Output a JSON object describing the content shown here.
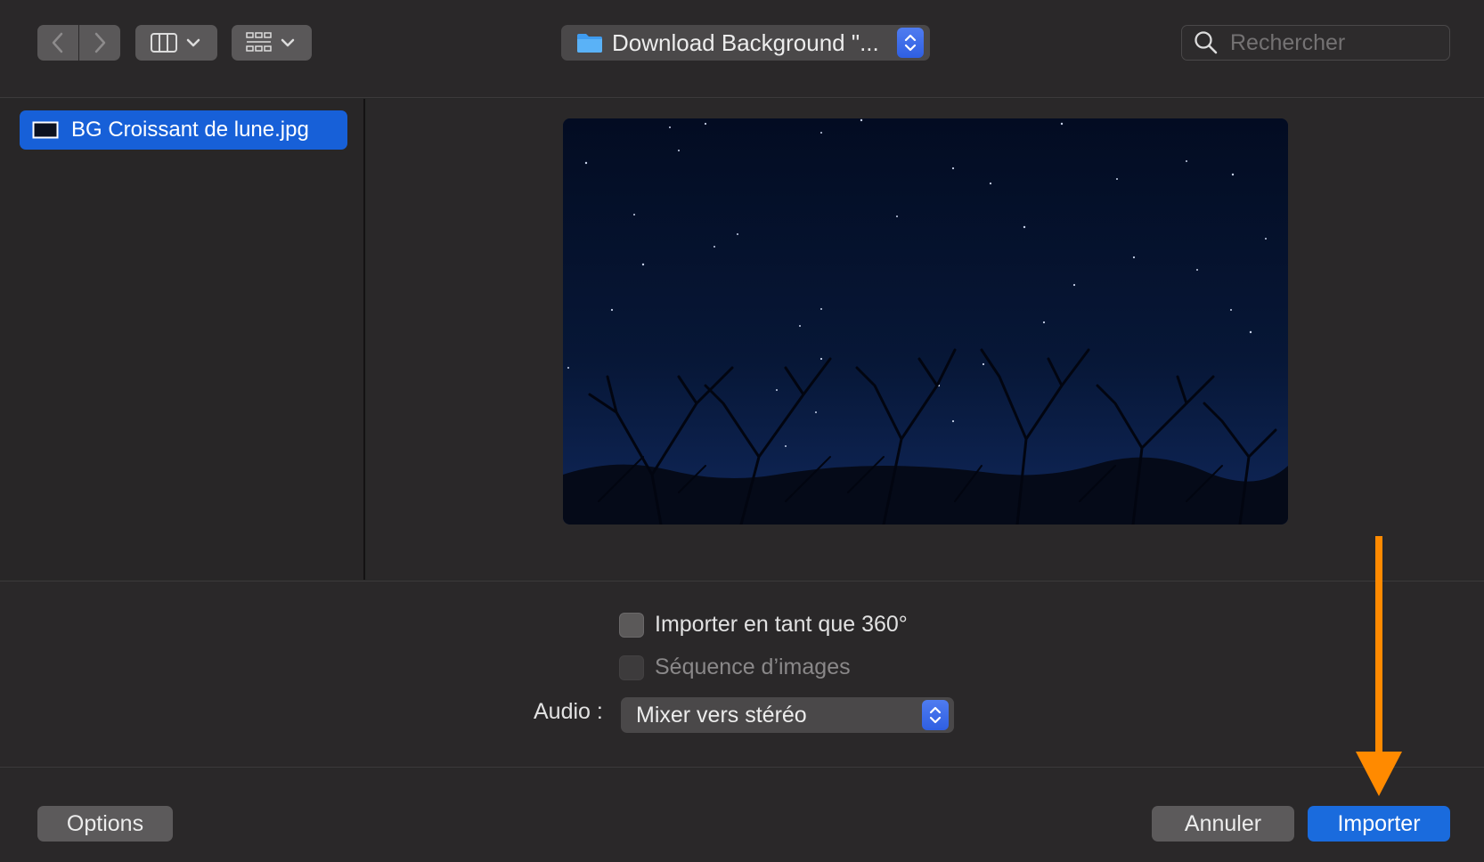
{
  "toolbar": {
    "path_label": "Download Background \"...",
    "search_placeholder": "Rechercher"
  },
  "sidebar": {
    "items": [
      {
        "label": "BG Croissant de lune.jpg",
        "selected": true
      }
    ]
  },
  "options": {
    "import_360_label": "Importer en tant que 360°",
    "import_360_checked": false,
    "image_sequence_label": "Séquence d’images",
    "image_sequence_enabled": false,
    "audio_label": "Audio :",
    "audio_value": "Mixer vers stéréo"
  },
  "footer": {
    "options_label": "Options",
    "cancel_label": "Annuler",
    "import_label": "Importer"
  },
  "colors": {
    "accent": "#1a6bdd",
    "annotation_arrow": "#ff8a00"
  }
}
